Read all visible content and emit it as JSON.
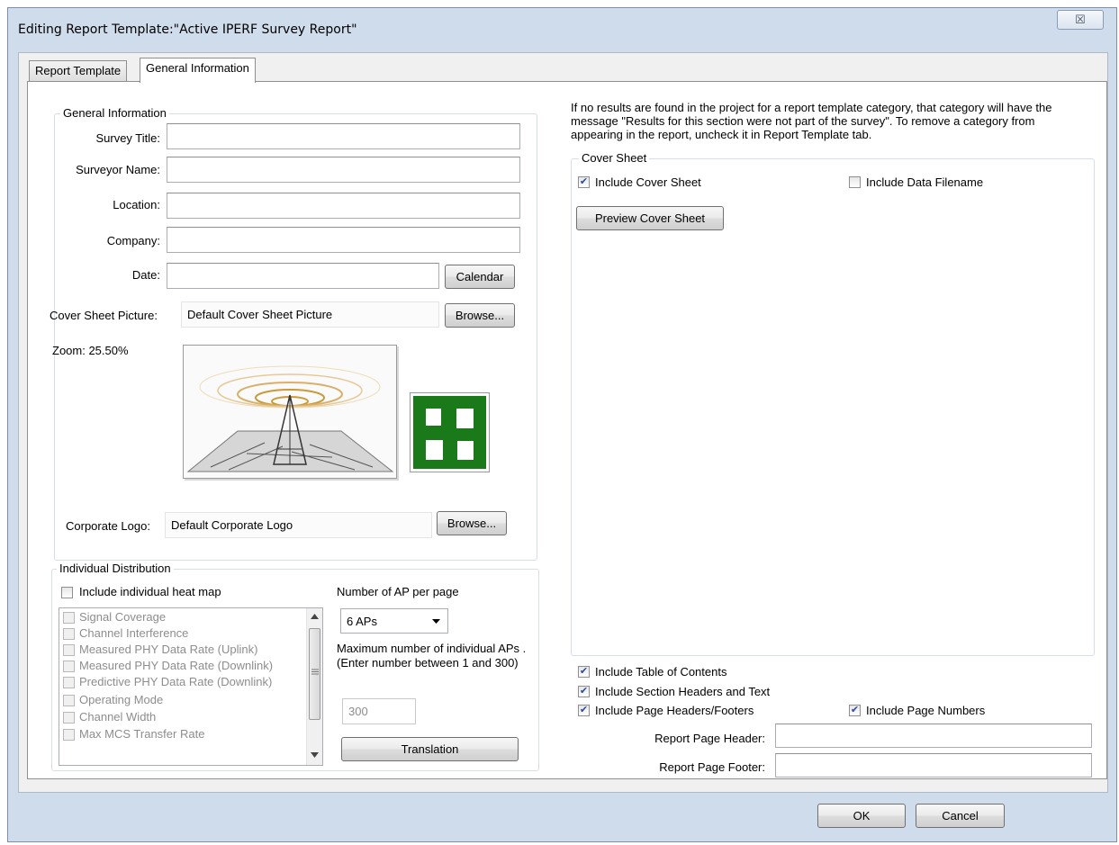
{
  "window": {
    "title": "Editing Report Template:\"Active IPERF Survey Report\"",
    "close_glyph": "☒"
  },
  "tabs": [
    {
      "label": "Report Template",
      "active": false
    },
    {
      "label": "General Information",
      "active": true
    }
  ],
  "general_info": {
    "group_label": "General Information",
    "survey_title_label": "Survey Title:",
    "survey_title_value": "",
    "surveyor_name_label": "Surveyor Name:",
    "surveyor_name_value": "",
    "location_label": "Location:",
    "location_value": "",
    "company_label": "Company:",
    "company_value": "",
    "date_label": "Date:",
    "date_value": "",
    "calendar_button": "Calendar",
    "cover_picture_label": "Cover Sheet Picture:",
    "cover_picture_value": "Default Cover Sheet Picture",
    "browse_button": "Browse...",
    "zoom_label": "Zoom: 25.50%",
    "corporate_logo_label": "Corporate Logo:",
    "corporate_logo_value": "Default Corporate Logo",
    "logo_browse_button": "Browse..."
  },
  "individual_distribution": {
    "group_label": "Individual Distribution",
    "include_heat_map_label": "Include individual heat map",
    "include_heat_map_checked": false,
    "items": [
      "Signal Coverage",
      "Channel Interference",
      "Measured PHY Data Rate (Uplink)",
      "Measured PHY Data Rate (Downlink)",
      "Predictive PHY Data Rate (Downlink)",
      "Operating Mode",
      "Channel Width",
      "Max MCS Transfer Rate"
    ],
    "ap_per_page_label": "Number of AP per page",
    "ap_per_page_value": "6 APs",
    "max_individual_note": "Maximum number of individual APs . (Enter number between 1 and 300)",
    "max_individual_value": "300",
    "translation_button": "Translation"
  },
  "info_text": "If no results are found in the project for a report template category, that category will have the message \"Results for this section were not part of the survey\". To remove a category from appearing in the report, uncheck it in Report Template tab.",
  "cover_sheet": {
    "group_label": "Cover Sheet",
    "include_cover_sheet_label": "Include Cover Sheet",
    "include_cover_sheet_checked": true,
    "include_data_filename_label": "Include Data Filename",
    "include_data_filename_checked": false,
    "preview_button": "Preview Cover Sheet"
  },
  "options": {
    "include_toc_label": "Include Table of Contents",
    "include_section_headers_label": "Include Section Headers and Text",
    "include_page_headers_label": "Include Page Headers/Footers",
    "include_page_numbers_label": "Include Page Numbers",
    "report_page_header_label": "Report Page Header:",
    "report_page_header_value": "",
    "report_page_footer_label": "Report Page Footer:",
    "report_page_footer_value": ""
  },
  "buttons": {
    "ok": "OK",
    "cancel": "Cancel"
  },
  "check_glyph": "✔",
  "colors": {
    "dialog_frame": "#cfdceb",
    "logo_green": "#1a7a1a"
  }
}
